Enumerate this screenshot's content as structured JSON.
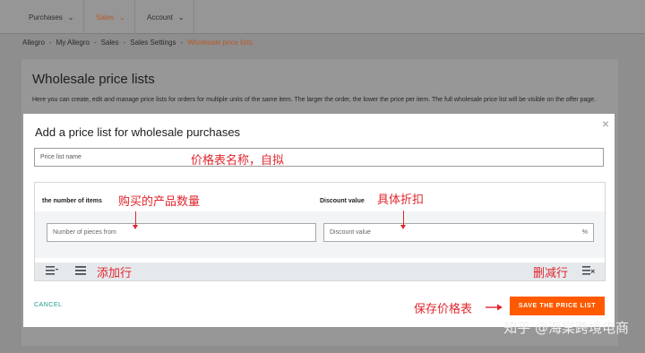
{
  "topnav": {
    "items": [
      {
        "label": "Purchases",
        "active": false
      },
      {
        "label": "Sales",
        "active": true
      },
      {
        "label": "Account",
        "active": false
      }
    ]
  },
  "breadcrumb": [
    "Allegro",
    "My Allegro",
    "Sales",
    "Sales Settings",
    "Wholesale price lists"
  ],
  "page": {
    "title": "Wholesale price lists",
    "description": "Here you can create, edit and manage price lists for orders for multiple units of the same item. The larger the order, the lower the price per item. The full wholesale price list will be visible on the offer page."
  },
  "modal": {
    "title": "Add a price list for wholesale purchases",
    "close": "×",
    "name_placeholder": "Price list name",
    "col_items": "the number of items",
    "col_discount": "Discount value",
    "pieces_placeholder": "Number of pieces from",
    "discount_placeholder": "Discount value",
    "percent": "%",
    "cancel_label": "CANCEL",
    "save_label": "SAVE THE PRICE LIST"
  },
  "annotations": {
    "name_note": "价格表名称，自拟",
    "qty_note": "购买的产品数量",
    "discount_note": "具体折扣",
    "add_row_note": "添加行",
    "delete_row_note": "删减行",
    "save_note": "保存价格表"
  },
  "watermark": "知乎 @海棠跨境电商",
  "colors": {
    "accent": "#ff5a00",
    "cancel": "#1b9e87",
    "annotation": "#e0262d"
  },
  "icons": [
    "chevron-down-icon",
    "close-icon",
    "add-row-icon",
    "delete-row-icon",
    "arrow-right-icon"
  ]
}
